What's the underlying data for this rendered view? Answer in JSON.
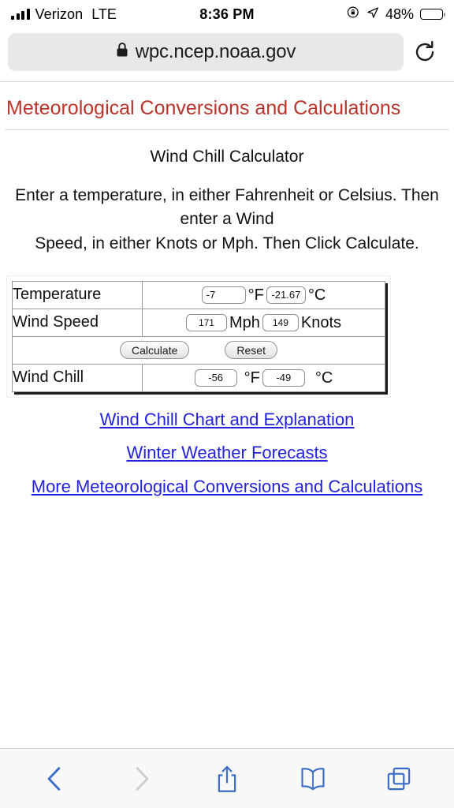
{
  "status_bar": {
    "carrier": "Verizon",
    "network": "LTE",
    "time": "8:36 PM",
    "battery_percent": "48%",
    "battery_level": 48,
    "icons": [
      "signal-bars-icon",
      "rotation-lock-icon",
      "location-arrow-icon",
      "battery-icon"
    ]
  },
  "browser": {
    "url": "wpc.ncep.noaa.gov",
    "lock_icon": "lock-icon",
    "reload_icon": "reload-icon",
    "toolbar": {
      "back_icon": "back-chevron-icon",
      "forward_icon": "forward-chevron-icon",
      "share_icon": "share-icon",
      "bookmarks_icon": "book-icon",
      "tabs_icon": "tabs-icon",
      "back_enabled": true,
      "forward_enabled": false
    }
  },
  "page": {
    "heading": "Meteorological Conversions and Calculations",
    "heading_color": "#b9342a",
    "subheading": "Wind Chill Calculator",
    "instructions_line1": "Enter a temperature, in either Fahrenheit or Celsius. Then enter a Wind",
    "instructions_line2": "Speed, in either Knots or Mph. Then Click Calculate.",
    "link_color": "#2222dd",
    "calculator": {
      "rows": [
        {
          "label": "Temperature",
          "field_a_value": "-7",
          "field_a_unit": "°F",
          "field_b_value": "-21.67",
          "field_b_unit": "°C"
        },
        {
          "label": "Wind Speed",
          "field_a_value": "171",
          "field_a_unit": "Mph",
          "field_b_value": "149",
          "field_b_unit": "Knots"
        },
        {
          "label": "Wind Chill",
          "field_a_value": "-56",
          "field_a_unit": "°F",
          "field_b_value": "-49",
          "field_b_unit": "°C"
        }
      ],
      "calculate_label": "Calculate",
      "reset_label": "Reset"
    },
    "links": [
      "Wind Chill Chart and Explanation",
      "Winter Weather Forecasts",
      "More Meteorological Conversions and Calculations"
    ]
  }
}
